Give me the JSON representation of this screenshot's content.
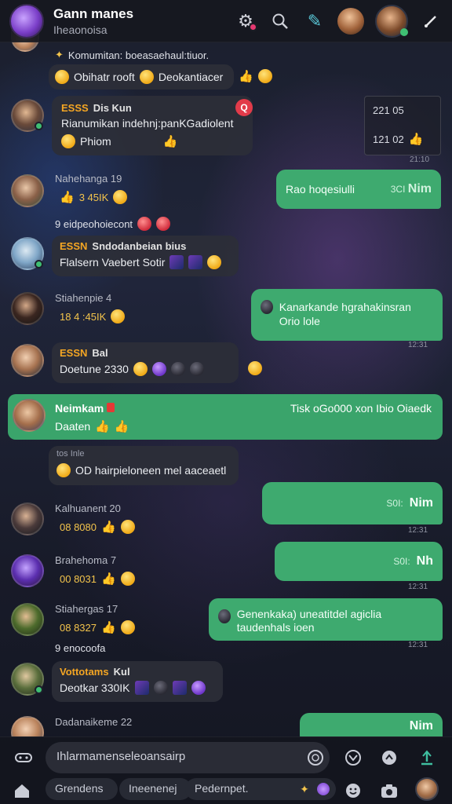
{
  "header": {
    "title": "Gann manes",
    "subtitle": "Iheaonoisa",
    "gear_icon": "gear-icon",
    "search_icon": "search-icon"
  },
  "messages": [
    {
      "id": "m0",
      "type": "reaction-row",
      "caption": "Komumitan: boeasaehaul:tiuor.",
      "text": "Obihatr rooft",
      "text2": "Deokantiacer"
    },
    {
      "id": "m1",
      "sender": "ESSS",
      "tag": "Dis Kun",
      "text": "Rianumikan indehnj:panKGadiolent",
      "sub": "Phiom",
      "badge": "Q",
      "quote_time1": "221 05",
      "quote_time2": "121 02",
      "time": "21:10"
    },
    {
      "id": "m2",
      "name": "Nahehanga 19",
      "reactions": "3 45IK",
      "out_text": "Rao hoqesiulli",
      "out_sub": "3CI",
      "out_suffix": "Nim"
    },
    {
      "id": "m3",
      "plain": "9 eidpeohoiecont"
    },
    {
      "id": "m4",
      "sender": "ESSN",
      "tag": "Sndodanbeian bius",
      "text": "Flalsern Vaebert Sotir"
    },
    {
      "id": "m5",
      "name": "Stiahenpie 4",
      "reactions": "18 4 :45IK",
      "out_text": "Kanarkande hgrahakinsran Orio lole",
      "time": "12:31"
    },
    {
      "id": "m6",
      "sender": "ESSN",
      "tag": "Bal",
      "text": "Doetune 2330"
    },
    {
      "id": "m7",
      "sender": "Neimkam",
      "tag": "",
      "text": "Daaten",
      "right": "Tisk oGo000 xon Ibio Oiaedk"
    },
    {
      "id": "m8",
      "fwd_head": "tos  Inle",
      "text": "OD hairpieloneen mel aaceaetl"
    },
    {
      "id": "m9",
      "name": "Kalhuanent 20",
      "reactions": "08 8080",
      "out_text": "S0I:",
      "out_suffix": "Nim",
      "time": "12:31"
    },
    {
      "id": "m10",
      "name": "Brahehoma 7",
      "reactions": "00 8031",
      "out_text": "S0I:",
      "out_suffix": "Nh",
      "time": "12:31"
    },
    {
      "id": "m11",
      "name": "Stiahergas 17",
      "reactions": "08 8327",
      "out_text": "Genenkaka) uneatitdel agiclia taudenhals ioen",
      "time": "12:31"
    },
    {
      "id": "m12",
      "plain": "9 enocoofa"
    },
    {
      "id": "m13",
      "sender": "Vottotams",
      "tag": "Kul",
      "text": "Deotkar 330IK"
    },
    {
      "id": "m14",
      "name": "Dadanaikeme 22",
      "out_suffix": "Nim"
    }
  ],
  "composer": {
    "placeholder": "Ihlarmamenseleoansairp",
    "chip1": "Grendens",
    "chip2": "Ineenenej",
    "chip3": "Pedernpet."
  }
}
